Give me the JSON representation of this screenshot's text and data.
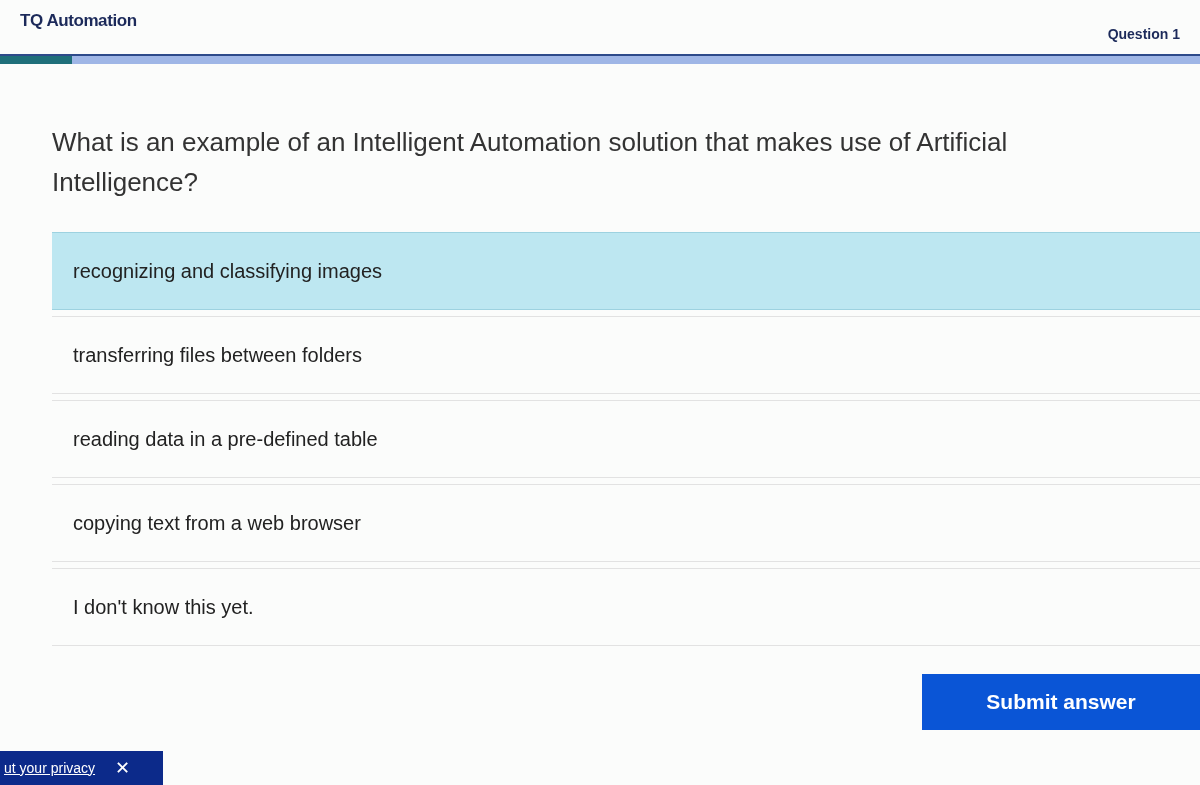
{
  "header": {
    "brand": "TQ Automation",
    "counter": "Question 1"
  },
  "progress": {
    "level": 0.06
  },
  "question": "What is an example of an Intelligent Automation solution that makes use of Artificial Intelligence?",
  "options": [
    {
      "label": "recognizing and classifying images",
      "selected": true
    },
    {
      "label": "transferring files between folders",
      "selected": false
    },
    {
      "label": "reading data in a pre-defined table",
      "selected": false
    },
    {
      "label": "copying text from a web browser",
      "selected": false
    },
    {
      "label": "I don't know this yet.",
      "selected": false
    }
  ],
  "submit": "Submit answer",
  "privacy_banner": {
    "link": "ut your privacy",
    "close": "✕"
  }
}
